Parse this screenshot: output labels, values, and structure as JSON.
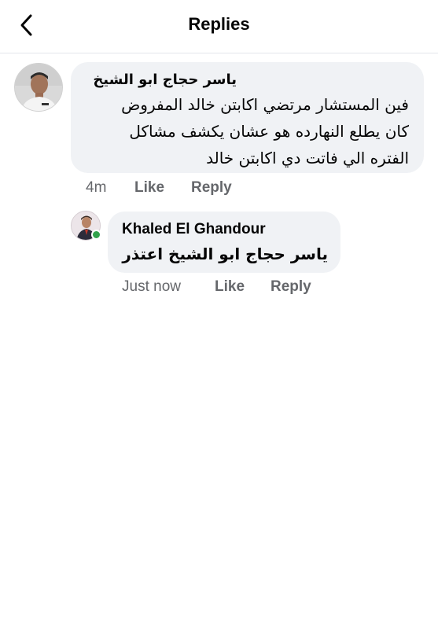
{
  "header": {
    "title": "Replies",
    "back_icon": "chevron-left-icon"
  },
  "comments": [
    {
      "author": "ياسر حجاج ابو الشيخ",
      "text": "فين المستشار مرتضي  اكابتن خالد المفروض\nكان يطلع النهارده هو عشان يكشف مشاكل\nالفتره الي فاتت دي اكابتن خالد",
      "time": "4m",
      "like_label": "Like",
      "reply_label": "Reply"
    },
    {
      "author": "Khaled El Ghandour",
      "text": "ياسر حجاج ابو الشيخ اعتذر",
      "time": "Just now",
      "like_label": "Like",
      "reply_label": "Reply",
      "online": true
    }
  ],
  "colors": {
    "bubble": "#f0f2f5",
    "meta": "#65676b",
    "online": "#31a24c"
  }
}
